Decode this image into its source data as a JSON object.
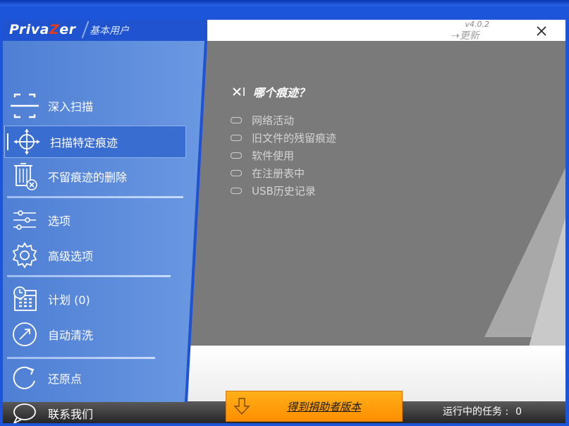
{
  "app": {
    "logo_prefix": "Priva",
    "logo_z": "Z",
    "logo_suffix": "er",
    "edition": "基本用户",
    "version": "v4.0.2",
    "update_label": "更新"
  },
  "sidebar": {
    "items": [
      {
        "label": "深入扫描",
        "icon": "scan-frame-icon"
      },
      {
        "label": "扫描特定痕迹",
        "icon": "crosshair-icon",
        "selected": true
      },
      {
        "label": "不留痕迹的删除",
        "icon": "trash-icon"
      },
      {
        "label": "选项",
        "icon": "sliders-icon"
      },
      {
        "label": "高级选项",
        "icon": "gear-icon"
      },
      {
        "label": "计划 (0)",
        "icon": "calendar-icon"
      },
      {
        "label": "自动清洗",
        "icon": "auto-clean-icon"
      },
      {
        "label": "还原点",
        "icon": "restore-icon"
      },
      {
        "label": "联系我们",
        "icon": "chat-bubble-icon"
      }
    ]
  },
  "content": {
    "title": "哪个痕迹？",
    "options": [
      {
        "label": "网络活动",
        "checked": false
      },
      {
        "label": "旧文件的残留痕迹",
        "checked": false
      },
      {
        "label": "软件使用",
        "checked": false
      },
      {
        "label": "在注册表中",
        "checked": false
      },
      {
        "label": "USB历史记录",
        "checked": false
      }
    ]
  },
  "footer": {
    "donor_label": "得到捐助者版本",
    "tasks_label": "运行中的任务 :",
    "tasks_count": "0"
  },
  "colors": {
    "sidebar_blue": "#5b8ad9",
    "accent_orange": "#ff9a00",
    "logo_red": "#e23b1e"
  }
}
